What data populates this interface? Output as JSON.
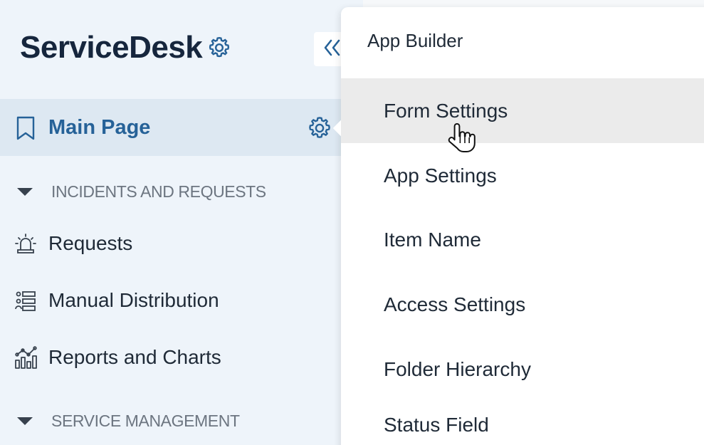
{
  "brand": {
    "name": "ServiceDesk",
    "settings_icon": "gear-icon"
  },
  "sidebar": {
    "collapse_icon": "double-chevron-left-icon",
    "main_page": {
      "label": "Main Page",
      "icon": "bookmark-icon",
      "settings_icon": "gear-icon"
    },
    "sections": [
      {
        "title": "INCIDENTS AND REQUESTS",
        "expand_icon": "triangle-down-icon"
      },
      {
        "title": "SERVICE MANAGEMENT",
        "expand_icon": "triangle-down-icon"
      }
    ],
    "items": [
      {
        "label": "Requests",
        "icon": "siren-icon"
      },
      {
        "label": "Manual Distribution",
        "icon": "list-distribution-icon"
      },
      {
        "label": "Reports and Charts",
        "icon": "chart-icon"
      }
    ]
  },
  "dropdown": {
    "heading": "App Builder",
    "items": [
      {
        "label": "Form Settings",
        "hovered": true
      },
      {
        "label": "App Settings"
      },
      {
        "label": "Item Name"
      },
      {
        "label": "Access Settings"
      },
      {
        "label": "Folder Hierarchy"
      },
      {
        "label": "Status Field"
      }
    ]
  },
  "colors": {
    "sidebar_bg": "#eef4fa",
    "active_bg": "#dde8f2",
    "accent": "#266298",
    "hover_bg": "#ebebeb"
  }
}
